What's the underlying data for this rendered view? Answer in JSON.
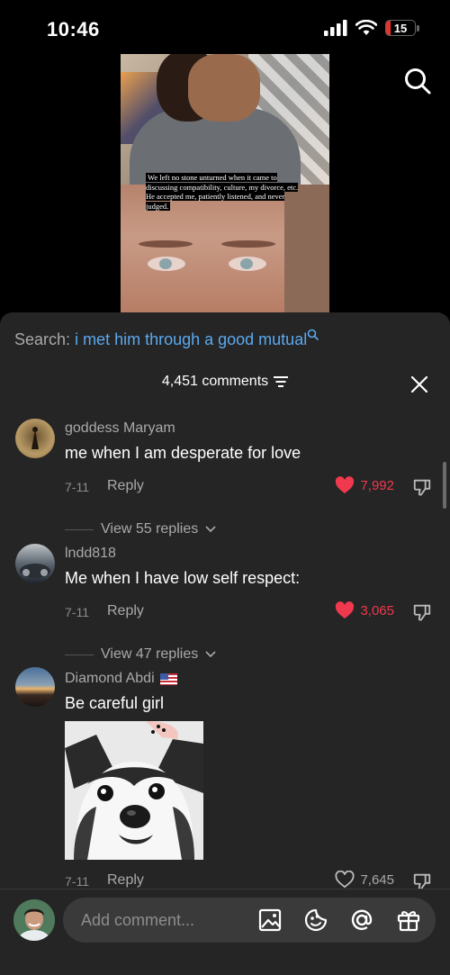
{
  "status_bar": {
    "time": "10:46",
    "battery": "15",
    "battery_level": 0.15
  },
  "video": {
    "caption": "We left no stone unturned when it came to discussing compatibility, culture, my divorce, etc. He accepted me, patiently listened, and never judged."
  },
  "search": {
    "label": "Search:",
    "query": "i met him through a good mutual"
  },
  "header": {
    "count": "4,451 comments"
  },
  "comments": [
    {
      "user": "goddess Maryam",
      "text": "me when I am desperate for love",
      "date": "7-11",
      "reply_label": "Reply",
      "likes": "7,992",
      "liked": true,
      "view_replies": "View 55 replies"
    },
    {
      "user": "lndd818",
      "text": "Me when I have low self respect:",
      "date": "7-11",
      "reply_label": "Reply",
      "likes": "3,065",
      "liked": true,
      "view_replies": "View 47 replies"
    },
    {
      "user": "Diamond Abdi",
      "flag": "us-flag",
      "text": "Be careful girl",
      "date": "7-11",
      "reply_label": "Reply",
      "likes": "7,645",
      "liked": false,
      "image": "husky-dog-photo"
    }
  ],
  "composer": {
    "placeholder": "Add comment...",
    "icons": [
      "image-icon",
      "emoji-icon",
      "mention-icon",
      "gift-icon"
    ]
  },
  "colors": {
    "accent_blue": "#5aa9f0",
    "like_red": "#f0384e",
    "sheet_bg": "#252525"
  }
}
